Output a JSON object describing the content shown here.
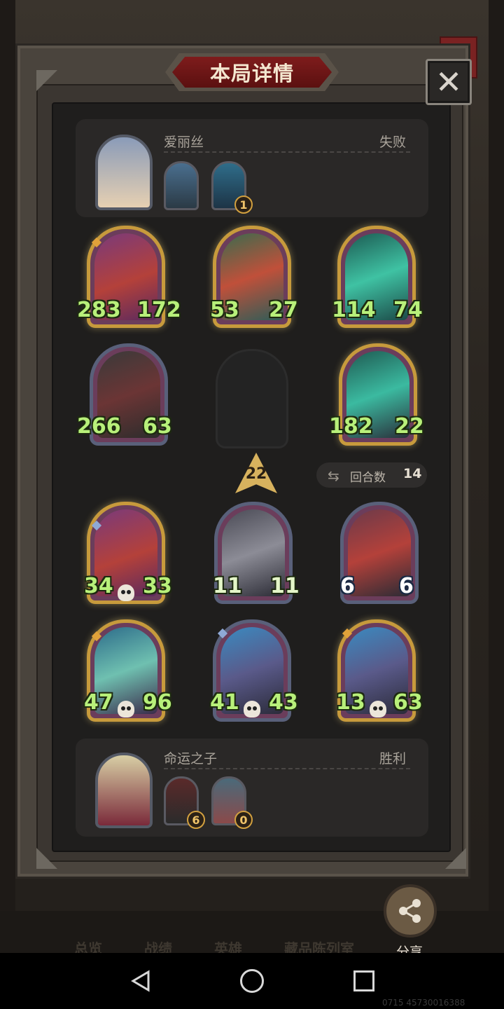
{
  "title": "本局详情",
  "close_label": "✕",
  "opponent": {
    "name": "爱丽丝",
    "result": "失败",
    "item_badge": "1"
  },
  "player": {
    "name": "命运之子",
    "result": "胜利",
    "item_badges": [
      "6",
      "0"
    ]
  },
  "opponent_board": [
    {
      "attack": "283",
      "health": "172"
    },
    {
      "attack": "53",
      "health": "27"
    },
    {
      "attack": "114",
      "health": "74"
    },
    {
      "attack": "266",
      "health": "63"
    },
    {
      "attack": "182",
      "health": "22"
    }
  ],
  "player_board": [
    {
      "attack": "34",
      "health": "33"
    },
    {
      "attack": "11",
      "health": "11"
    },
    {
      "attack": "6",
      "health": "6"
    },
    {
      "attack": "47",
      "health": "96"
    },
    {
      "attack": "41",
      "health": "43"
    },
    {
      "attack": "13",
      "health": "63"
    }
  ],
  "level": "22",
  "rounds": {
    "label": "回合数",
    "value": "14"
  },
  "share_label": "分享",
  "bottom_menu": [
    "总览",
    "战绩",
    "英雄",
    "藏品陈列室"
  ],
  "watermark": "0715 45730016388",
  "colors": {
    "gold_frame": "#c79a3c",
    "stat_green": "#b8f07a",
    "title_red": "#7e1c1c"
  }
}
